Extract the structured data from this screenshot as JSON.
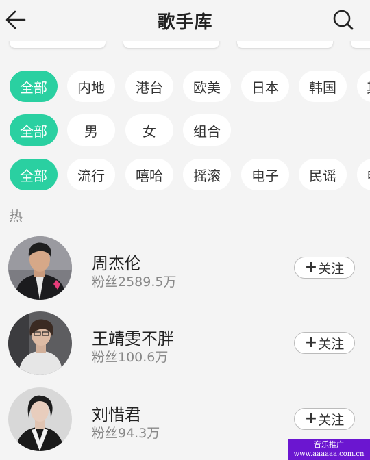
{
  "header": {
    "title": "歌手库",
    "back_icon": "arrow-left-icon",
    "search_icon": "search-icon"
  },
  "filters": {
    "region": [
      "全部",
      "内地",
      "港台",
      "欧美",
      "日本",
      "韩国",
      "其"
    ],
    "gender": [
      "全部",
      "男",
      "女",
      "组合"
    ],
    "genre": [
      "全部",
      "流行",
      "嘻哈",
      "摇滚",
      "电子",
      "民谣",
      "电"
    ]
  },
  "section_label": "热",
  "artists": [
    {
      "name": "周杰伦",
      "fans": "粉丝2589.5万",
      "follow": "关注"
    },
    {
      "name": "王靖雯不胖",
      "fans": "粉丝100.6万",
      "follow": "关注"
    },
    {
      "name": "刘惜君",
      "fans": "粉丝94.3万",
      "follow": "关注"
    }
  ],
  "colors": {
    "accent": "#2ad0a1",
    "background": "#f4f4f4",
    "watermark": "#6b16d0"
  },
  "watermark": {
    "line1": "音乐推广",
    "line2": "www.aaaaaa.com.cn"
  }
}
